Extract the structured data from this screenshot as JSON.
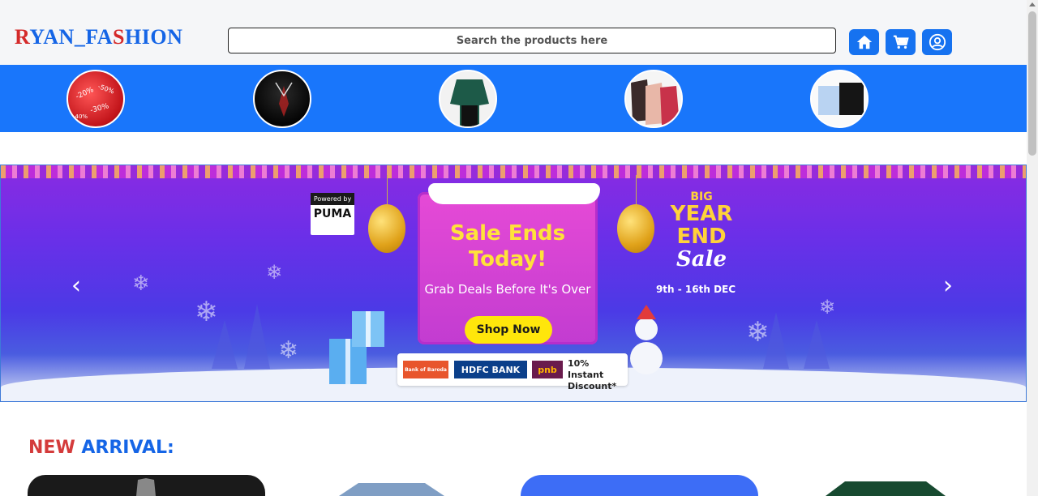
{
  "header": {
    "brand_first": "R",
    "brand_rest": "YAN_FA",
    "brand_s": "S",
    "brand_end": "HION",
    "search_placeholder": "Search the products here",
    "icons": [
      "home-icon",
      "cart-icon",
      "user-icon"
    ]
  },
  "categories": [
    {
      "name": "sale-tags"
    },
    {
      "name": "suits"
    },
    {
      "name": "women-dresses"
    },
    {
      "name": "kids-wear"
    },
    {
      "name": "shirts"
    }
  ],
  "banner": {
    "powered_by": "Powered by",
    "powered_brand": "PUMA",
    "title_line1": "Sale Ends",
    "title_line2": "Today!",
    "subtitle": "Grab Deals Before It's Over",
    "cta": "Shop Now",
    "big": "BIG",
    "year_end": "YEAR END",
    "sale": "Sale",
    "dates": "9th - 16th DEC",
    "bank_1": "Bank of Baroda",
    "bank_2": "HDFC BANK",
    "bank_3": "pnb",
    "discount_line1": "10% Instant",
    "discount_line2": "Discount*",
    "prev_arrow": "‹",
    "next_arrow": "›"
  },
  "section": {
    "title_part1": "NEW",
    "title_part2": "ARRIVAL:"
  },
  "colors": {
    "brand_blue": "#1565e6",
    "brand_red": "#d42a2a",
    "category_bar": "#1976fb",
    "button_blue": "#1672f0"
  }
}
